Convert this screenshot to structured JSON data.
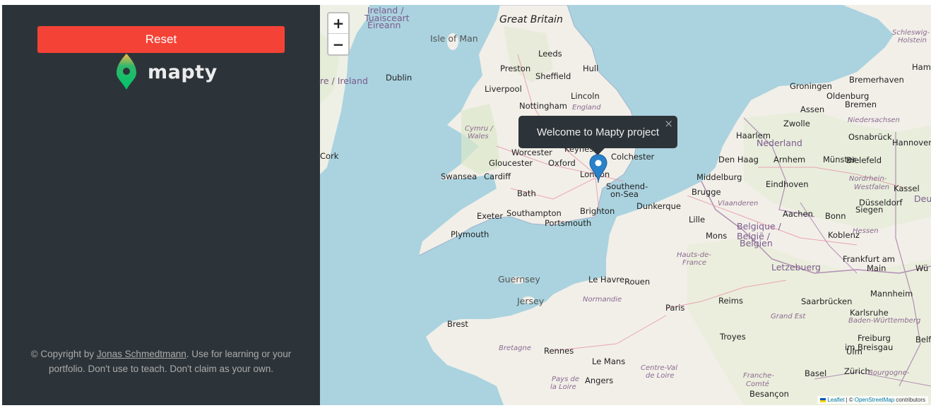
{
  "sidebar": {
    "reset_label": "Reset",
    "logo_text": "mapty",
    "copyright_prefix": "© Copyright by ",
    "copyright_author": "Jonas Schmedtmann",
    "copyright_suffix": ". Use for learning or your portfolio. Don't use to teach. Don't claim as your own."
  },
  "map": {
    "zoom_in": "+",
    "zoom_out": "−",
    "popup_text": "Welcome to Mapty project",
    "popup_close": "×",
    "attribution": {
      "leaflet": "Leaflet",
      "separator": "| ©",
      "osm": "OpenStreetMap",
      "contributors": "contributors"
    },
    "labels": [
      {
        "text": "Ireland /",
        "cls": "country"
      },
      {
        "text": "Tuaisceart",
        "cls": "country"
      },
      {
        "text": "Éireann",
        "cls": "country"
      },
      {
        "text": "Great Britain",
        "cls": "big"
      },
      {
        "text": "Isle of Man",
        "cls": "island"
      },
      {
        "text": "Leeds",
        "cls": "city"
      },
      {
        "text": "Preston",
        "cls": "city"
      },
      {
        "text": "Hull",
        "cls": "city"
      },
      {
        "text": "Sheffield",
        "cls": "city"
      },
      {
        "text": "Dublin",
        "cls": "city"
      },
      {
        "text": "re / Ireland",
        "cls": "country"
      },
      {
        "text": "Liverpool",
        "cls": "city"
      },
      {
        "text": "Lincoln",
        "cls": "city"
      },
      {
        "text": "Nottingham",
        "cls": "city"
      },
      {
        "text": "England",
        "cls": "region"
      },
      {
        "text": "Cymru /",
        "cls": "region"
      },
      {
        "text": "Wales",
        "cls": "region"
      },
      {
        "text": "Cork",
        "cls": "city"
      },
      {
        "text": "Worcester",
        "cls": "city"
      },
      {
        "text": "Keynes",
        "cls": "city"
      },
      {
        "text": "Colchester",
        "cls": "city"
      },
      {
        "text": "Gloucester",
        "cls": "city"
      },
      {
        "text": "Oxford",
        "cls": "city"
      },
      {
        "text": "London",
        "cls": "city"
      },
      {
        "text": "Swansea",
        "cls": "city"
      },
      {
        "text": "Cardiff",
        "cls": "city"
      },
      {
        "text": "Southend-",
        "cls": "city"
      },
      {
        "text": "on-Sea",
        "cls": "city"
      },
      {
        "text": "Bath",
        "cls": "city"
      },
      {
        "text": "Dunkerque",
        "cls": "city"
      },
      {
        "text": "Exeter",
        "cls": "city"
      },
      {
        "text": "Southampton",
        "cls": "city"
      },
      {
        "text": "Brighton",
        "cls": "city"
      },
      {
        "text": "Portsmouth",
        "cls": "city"
      },
      {
        "text": "Plymouth",
        "cls": "city"
      },
      {
        "text": "Guernsey",
        "cls": "island"
      },
      {
        "text": "Jersey",
        "cls": "island"
      },
      {
        "text": "Le Havre",
        "cls": "city"
      },
      {
        "text": "Rouen",
        "cls": "city"
      },
      {
        "text": "Normandie",
        "cls": "region"
      },
      {
        "text": "Paris",
        "cls": "city"
      },
      {
        "text": "Brest",
        "cls": "city"
      },
      {
        "text": "Bretagne",
        "cls": "region"
      },
      {
        "text": "Rennes",
        "cls": "city"
      },
      {
        "text": "Le Mans",
        "cls": "city"
      },
      {
        "text": "Pays de",
        "cls": "region"
      },
      {
        "text": "la Loire",
        "cls": "region"
      },
      {
        "text": "Angers",
        "cls": "city"
      },
      {
        "text": "Centre-Val",
        "cls": "region"
      },
      {
        "text": "de Loire",
        "cls": "region"
      },
      {
        "text": "Troyes",
        "cls": "city"
      },
      {
        "text": "Reims",
        "cls": "city"
      },
      {
        "text": "Grand Est",
        "cls": "region"
      },
      {
        "text": "Hauts-de-",
        "cls": "region"
      },
      {
        "text": "France",
        "cls": "region"
      },
      {
        "text": "Lille",
        "cls": "city"
      },
      {
        "text": "Mons",
        "cls": "city"
      },
      {
        "text": "Belgique /",
        "cls": "country"
      },
      {
        "text": "België /",
        "cls": "country"
      },
      {
        "text": "Belgien",
        "cls": "country"
      },
      {
        "text": "Brugge",
        "cls": "city"
      },
      {
        "text": "Vlaanderen",
        "cls": "region"
      },
      {
        "text": "Middelburg",
        "cls": "city"
      },
      {
        "text": "Den Haag",
        "cls": "city"
      },
      {
        "text": "Haarlem",
        "cls": "city"
      },
      {
        "text": "Nederland",
        "cls": "country"
      },
      {
        "text": "Eindhoven",
        "cls": "city"
      },
      {
        "text": "Arnhem",
        "cls": "city"
      },
      {
        "text": "Zwolle",
        "cls": "city"
      },
      {
        "text": "Groningen",
        "cls": "city"
      },
      {
        "text": "Assen",
        "cls": "city"
      },
      {
        "text": "Münster",
        "cls": "city"
      },
      {
        "text": "Bielefeld",
        "cls": "city"
      },
      {
        "text": "Oldenburg",
        "cls": "city"
      },
      {
        "text": "Bremerhaven",
        "cls": "city"
      },
      {
        "text": "Bremen",
        "cls": "city"
      },
      {
        "text": "Niedersachsen",
        "cls": "region"
      },
      {
        "text": "Osnabrück",
        "cls": "city"
      },
      {
        "text": "Hannover",
        "cls": "city"
      },
      {
        "text": "Hamburg",
        "cls": "city"
      },
      {
        "text": "Schleswig-",
        "cls": "region"
      },
      {
        "text": "Holstein",
        "cls": "region"
      },
      {
        "text": "Düsseldorf",
        "cls": "city"
      },
      {
        "text": "Nordrhein-",
        "cls": "region"
      },
      {
        "text": "Westfalen",
        "cls": "region"
      },
      {
        "text": "Aachen",
        "cls": "city"
      },
      {
        "text": "Bonn",
        "cls": "city"
      },
      {
        "text": "Siegen",
        "cls": "city"
      },
      {
        "text": "Kassel",
        "cls": "city"
      },
      {
        "text": "Deu",
        "cls": "country"
      },
      {
        "text": "Koblenz",
        "cls": "city"
      },
      {
        "text": "Hessen",
        "cls": "region"
      },
      {
        "text": "Letzebuerg",
        "cls": "country"
      },
      {
        "text": "Frankfurt am",
        "cls": "city"
      },
      {
        "text": "Main",
        "cls": "city"
      },
      {
        "text": "Wü",
        "cls": "city"
      },
      {
        "text": "Mannheim",
        "cls": "city"
      },
      {
        "text": "Saarbrücken",
        "cls": "city"
      },
      {
        "text": "Karlsruhe",
        "cls": "city"
      },
      {
        "text": "Baden-Württemberg",
        "cls": "region"
      },
      {
        "text": "Freiburg",
        "cls": "city"
      },
      {
        "text": "im Breisgau",
        "cls": "city"
      },
      {
        "text": "Ulm",
        "cls": "city"
      },
      {
        "text": "Belfort",
        "cls": "city"
      },
      {
        "text": "Basel",
        "cls": "city"
      },
      {
        "text": "Zürich",
        "cls": "city"
      },
      {
        "text": "Bourgogne-",
        "cls": "region"
      },
      {
        "text": "Franche-",
        "cls": "region"
      },
      {
        "text": "Comté",
        "cls": "region"
      },
      {
        "text": "Besançon",
        "cls": "city"
      }
    ]
  }
}
